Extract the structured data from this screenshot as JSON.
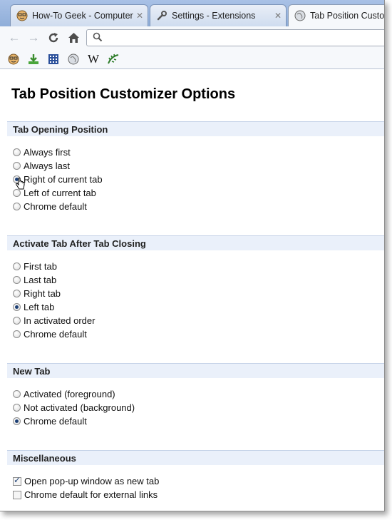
{
  "tabs": [
    {
      "title": "How-To Geek - Computer H",
      "icon": "geek-face-icon",
      "active": false
    },
    {
      "title": "Settings - Extensions",
      "icon": "wrench-icon",
      "active": false
    },
    {
      "title": "Tab Position Custom",
      "icon": "globe-icon",
      "active": true
    }
  ],
  "omnibox": {
    "value": "",
    "placeholder": ""
  },
  "bookmarks": [
    "geek-face-icon",
    "download-icon",
    "grid-icon",
    "globe-icon",
    "wikipedia-icon",
    "fern-icon"
  ],
  "bookmark_labels": {
    "wikipedia": "W"
  },
  "page": {
    "title": "Tab Position Customizer Options",
    "sections": [
      {
        "header": "Tab Opening Position",
        "type": "radio",
        "options": [
          "Always first",
          "Always last",
          "Right of current tab",
          "Left of current tab",
          "Chrome default"
        ],
        "selected": 2
      },
      {
        "header": "Activate Tab After Tab Closing",
        "type": "radio",
        "options": [
          "First tab",
          "Last tab",
          "Right tab",
          "Left tab",
          "In activated order",
          "Chrome default"
        ],
        "selected": 3
      },
      {
        "header": "New Tab",
        "type": "radio",
        "options": [
          "Activated (foreground)",
          "Not activated (background)",
          "Chrome default"
        ],
        "selected": 2
      },
      {
        "header": "Miscellaneous",
        "type": "checkbox",
        "options": [
          "Open pop-up window as new tab",
          "Chrome default for external links"
        ],
        "checked": [
          true,
          false
        ]
      }
    ]
  }
}
